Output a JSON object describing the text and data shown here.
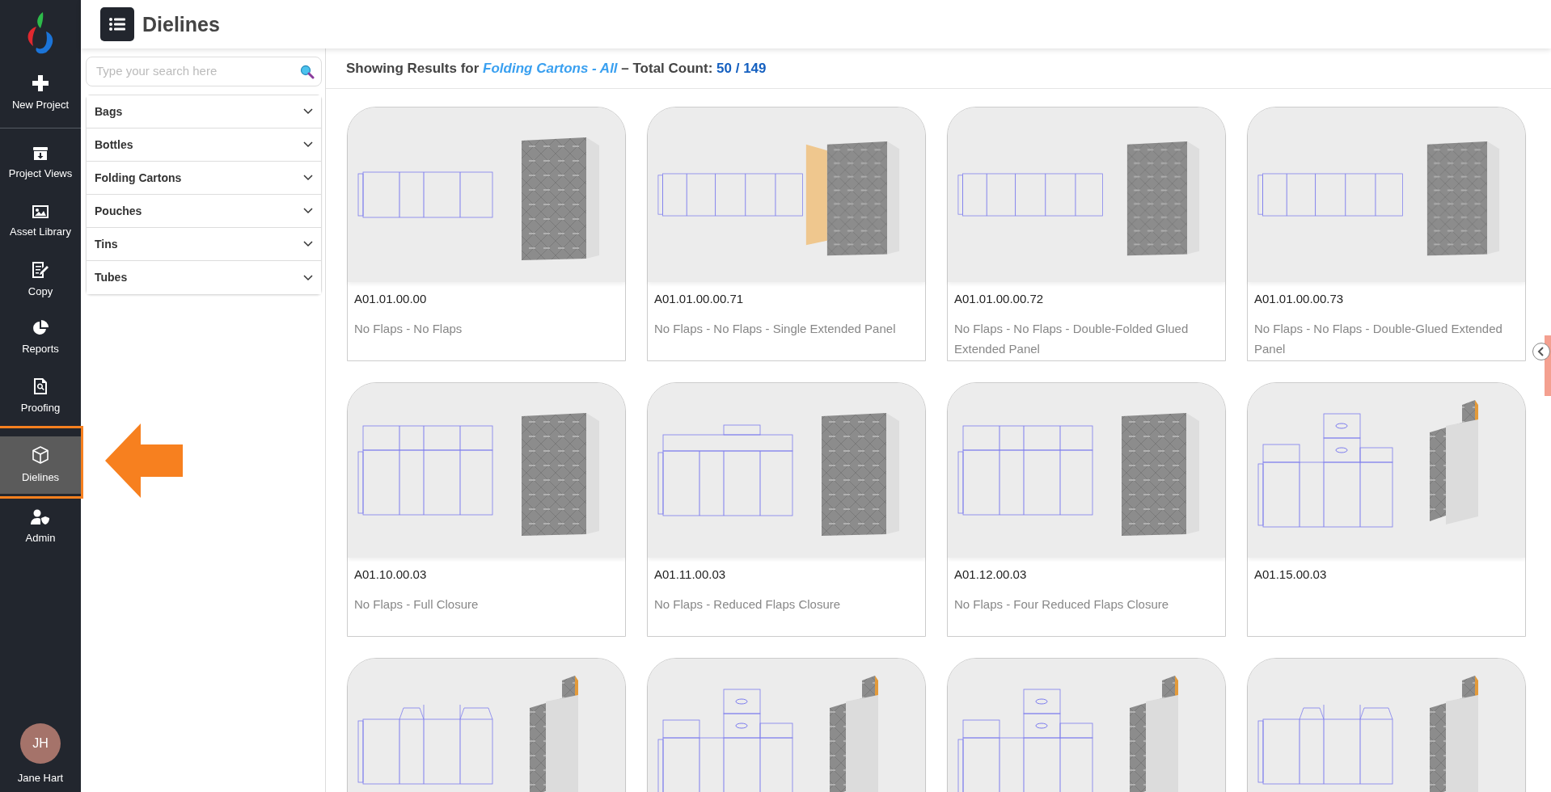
{
  "header": {
    "title": "Dielines"
  },
  "sidebar": {
    "items": [
      {
        "label": "New Project",
        "selected": false
      },
      {
        "label": "Project Views",
        "selected": false
      },
      {
        "label": "Asset Library",
        "selected": false
      },
      {
        "label": "Copy",
        "selected": false
      },
      {
        "label": "Reports",
        "selected": false
      },
      {
        "label": "Proofing",
        "selected": false
      },
      {
        "label": "Dielines",
        "selected": true
      },
      {
        "label": "Admin",
        "selected": false
      }
    ],
    "user": {
      "initials": "JH",
      "name": "Jane Hart"
    }
  },
  "filters": {
    "search": {
      "placeholder": "Type your search here"
    },
    "categories": [
      {
        "label": "Bags",
        "expanded": false
      },
      {
        "label": "Bottles",
        "expanded": false
      },
      {
        "label": "Folding Cartons",
        "expanded": false
      },
      {
        "label": "Pouches",
        "expanded": false
      },
      {
        "label": "Tins",
        "expanded": false
      },
      {
        "label": "Tubes",
        "expanded": false
      }
    ]
  },
  "results": {
    "label": "Showing Results for",
    "filter": "Folding Cartons - All",
    "count_label": "– Total Count:",
    "count": "50 / 149",
    "items": [
      {
        "kind": "plain",
        "code": "A01.01.00.00",
        "description": "No Flaps - No Flaps"
      },
      {
        "kind": "extended",
        "code": "A01.01.00.00.71",
        "description": "No Flaps - No Flaps - Single Extended Panel"
      },
      {
        "kind": "folded",
        "code": "A01.01.00.00.72",
        "description": "No Flaps - No Flaps - Double-Folded Glued Extended Panel"
      },
      {
        "kind": "glued",
        "code": "A01.01.00.00.73",
        "description": "No Flaps - No Flaps - Double-Glued Extended Panel"
      },
      {
        "kind": "closure",
        "code": "A01.10.00.03",
        "description": "No Flaps - Full Closure"
      },
      {
        "kind": "reduced",
        "code": "A01.11.00.03",
        "description": "No Flaps - Reduced Flaps Closure"
      },
      {
        "kind": "closure",
        "code": "A01.12.00.03",
        "description": "No Flaps - Four Reduced Flaps Closure"
      },
      {
        "kind": "hanger",
        "code": "A01.15.00.03"
      },
      {
        "kind": "tuck"
      },
      {
        "kind": "hanger"
      },
      {
        "kind": "hanger"
      },
      {
        "kind": "tuck"
      }
    ]
  }
}
